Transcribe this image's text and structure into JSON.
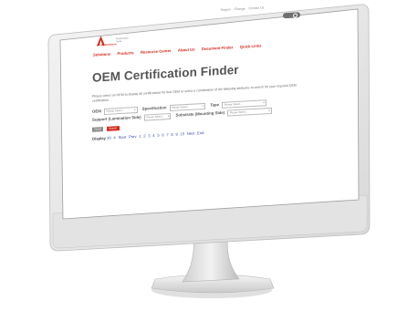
{
  "topbar": {
    "region": "Region",
    "change": "Change",
    "contact": "Contact Us"
  },
  "logo": {
    "brand": "AVERY DENNISON",
    "division_line1": "Performance",
    "division_line2": "Tapes"
  },
  "nav": [
    "Solutions",
    "Products",
    "Resource Center",
    "About Us",
    "Document Finder",
    "Quick Links"
  ],
  "page": {
    "title": "OEM Certification Finder",
    "intro": "Please select an OEM to display all certifications for that OEM or select a combination of the following attributes to search for your required OEM certification."
  },
  "filters": {
    "oem_label": "OEM",
    "oem_value": "Please Select...",
    "spec_label": "Specification",
    "spec_value": "Please Select...",
    "tape_label": "Tape",
    "tape_value": "Please Select...",
    "support_label": "Support (Lamination Side)",
    "support_value": "Please Select...",
    "substrate_label": "Substrate (Mounting Side)",
    "substrate_value": "Please Select..."
  },
  "buttons": {
    "reset": "Reset",
    "search": "Search"
  },
  "pager": {
    "display": "Display",
    "display_a": "20",
    "display_b": "4",
    "start": "Start",
    "prev": "Prev",
    "pages": [
      "1",
      "2",
      "3",
      "4",
      "5",
      "6",
      "7",
      "8",
      "9",
      "10"
    ],
    "next": "Next",
    "end": "End"
  },
  "colors": {
    "brand_red": "#d52b1e",
    "link_blue": "#3a4fb3",
    "title_grey": "#555555"
  }
}
